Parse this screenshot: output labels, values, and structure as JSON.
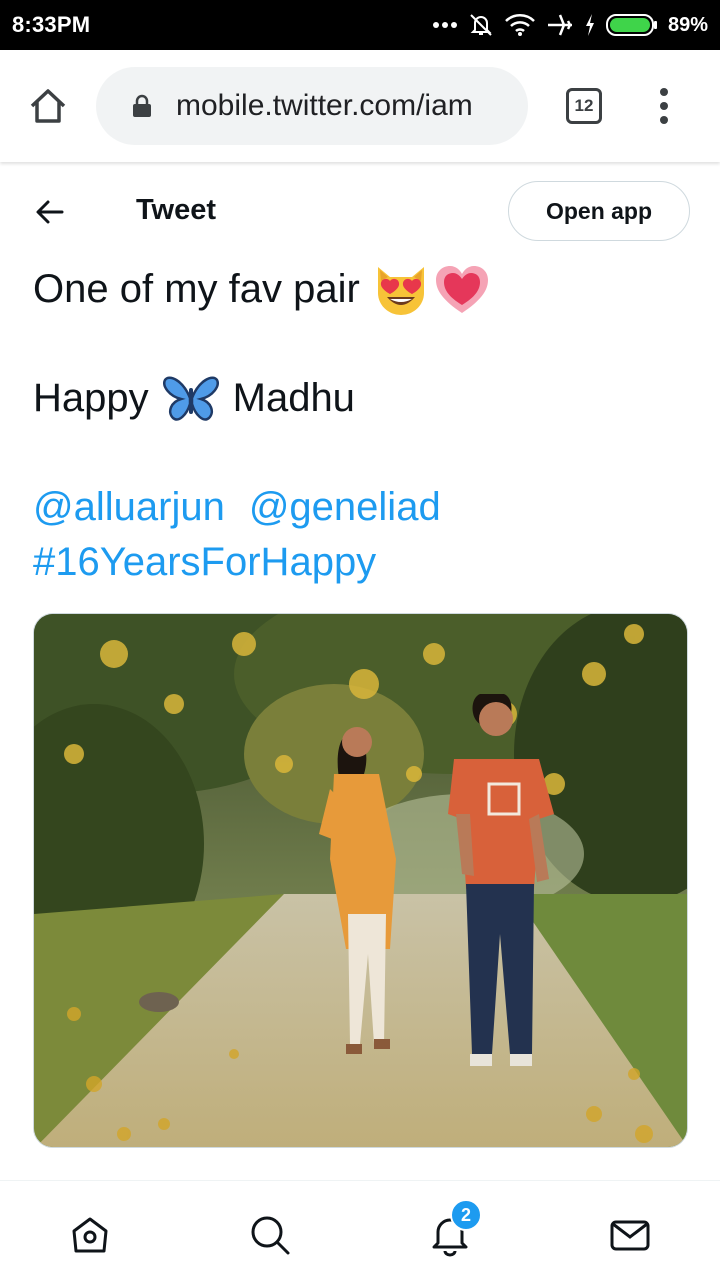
{
  "status_bar": {
    "time": "8:33PM",
    "battery": "89%",
    "icons": [
      "more-dots-icon",
      "muted-bell-icon",
      "wifi-icon",
      "airplane-icon",
      "charging-icon",
      "battery-icon"
    ]
  },
  "browser": {
    "url": "mobile.twitter.com/iam",
    "tab_count": "12",
    "icons": [
      "home-icon",
      "lock-icon",
      "tabs-icon",
      "overflow-menu-icon"
    ]
  },
  "header": {
    "title": "Tweet",
    "open_app_label": "Open app"
  },
  "tweet": {
    "line1": "One of my fav pair",
    "line2_before": "Happy",
    "line2_after": "Madhu",
    "mention1": "@alluarjun",
    "mention2": "@geneliad",
    "hashtag": "#16YearsForHappy",
    "emojis": [
      "heart-eyes-cat-emoji",
      "growing-heart-emoji",
      "butterfly-emoji"
    ]
  },
  "bottom_nav": {
    "items": [
      "home",
      "explore",
      "notifications",
      "messages"
    ],
    "notifications_badge": "2"
  },
  "colors": {
    "link": "#1d9bf0",
    "text": "#0f1419",
    "border": "#cfd9de"
  }
}
